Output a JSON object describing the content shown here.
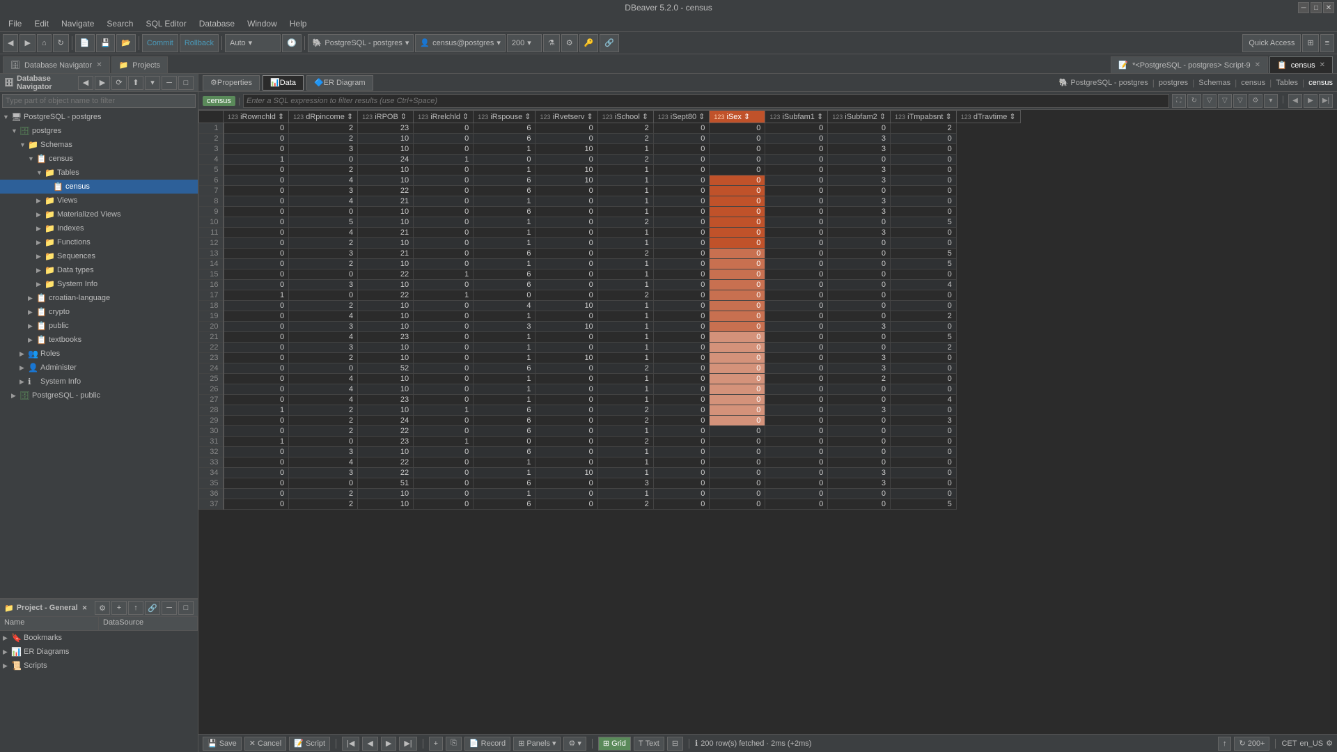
{
  "titlebar": {
    "title": "DBeaver 5.2.0 - census"
  },
  "menubar": {
    "items": [
      "File",
      "Edit",
      "Navigate",
      "Search",
      "SQL Editor",
      "Database",
      "Window",
      "Help"
    ]
  },
  "toolbar": {
    "commit_label": "Commit",
    "rollback_label": "Rollback",
    "auto_label": "Auto",
    "db_connection": "PostgreSQL - postgres",
    "schema": "census@postgres",
    "limit": "200",
    "quick_access": "Quick Access"
  },
  "tabs": {
    "items": [
      {
        "label": "Database Navigator",
        "active": false,
        "closeable": true
      },
      {
        "label": "Projects",
        "active": false,
        "closeable": false
      }
    ],
    "editor_tabs": [
      {
        "label": "*<PostgreSQL - postgres> Script-9",
        "active": false,
        "closeable": true
      },
      {
        "label": "census",
        "active": true,
        "closeable": true
      }
    ]
  },
  "navigator": {
    "title": "Database Navigator",
    "search_placeholder": "Type part of object name to filter",
    "tree": [
      {
        "level": 0,
        "expanded": true,
        "icon": "🖥",
        "label": "PostgreSQL - postgres"
      },
      {
        "level": 1,
        "expanded": true,
        "icon": "🗄",
        "label": "postgres"
      },
      {
        "level": 2,
        "expanded": true,
        "icon": "📁",
        "label": "Schemas"
      },
      {
        "level": 3,
        "expanded": true,
        "icon": "📋",
        "label": "census"
      },
      {
        "level": 4,
        "expanded": true,
        "icon": "📁",
        "label": "Tables"
      },
      {
        "level": 5,
        "expanded": false,
        "icon": "📋",
        "label": "census",
        "selected": true
      },
      {
        "level": 4,
        "expanded": false,
        "icon": "📁",
        "label": "Views"
      },
      {
        "level": 4,
        "expanded": false,
        "icon": "📁",
        "label": "Materialized Views"
      },
      {
        "level": 4,
        "expanded": false,
        "icon": "📁",
        "label": "Indexes"
      },
      {
        "level": 4,
        "expanded": false,
        "icon": "📁",
        "label": "Functions"
      },
      {
        "level": 4,
        "expanded": false,
        "icon": "📁",
        "label": "Sequences"
      },
      {
        "level": 4,
        "expanded": false,
        "icon": "📁",
        "label": "Data types"
      },
      {
        "level": 4,
        "expanded": false,
        "icon": "📁",
        "label": "System Info"
      },
      {
        "level": 3,
        "expanded": false,
        "icon": "📋",
        "label": "croatian-language"
      },
      {
        "level": 3,
        "expanded": false,
        "icon": "📋",
        "label": "crypto"
      },
      {
        "level": 3,
        "expanded": false,
        "icon": "📋",
        "label": "public"
      },
      {
        "level": 3,
        "expanded": false,
        "icon": "📋",
        "label": "textbooks"
      },
      {
        "level": 2,
        "expanded": false,
        "icon": "👥",
        "label": "Roles"
      },
      {
        "level": 2,
        "expanded": false,
        "icon": "👤",
        "label": "Administer"
      },
      {
        "level": 2,
        "expanded": false,
        "icon": "ℹ",
        "label": "System Info"
      },
      {
        "level": 1,
        "expanded": false,
        "icon": "🗄",
        "label": "PostgreSQL - public"
      }
    ]
  },
  "project_panel": {
    "title": "Project - General",
    "columns": [
      "Name",
      "DataSource"
    ],
    "items": [
      {
        "icon": "🔖",
        "label": "Bookmarks",
        "expanded": false
      },
      {
        "icon": "📊",
        "label": "ER Diagrams",
        "expanded": false
      },
      {
        "icon": "📜",
        "label": "Scripts",
        "expanded": false
      }
    ]
  },
  "data_panel": {
    "tabs": [
      "Properties",
      "Data",
      "ER Diagram"
    ],
    "active_tab": "Data",
    "filter_placeholder": "Enter a SQL expression to filter results (use Ctrl+Space)",
    "table_name": "census",
    "columns": [
      {
        "name": "iRownchld",
        "type": "123"
      },
      {
        "name": "dRpincome",
        "type": "123"
      },
      {
        "name": "iRPOB",
        "type": "123"
      },
      {
        "name": "iRrelchld",
        "type": "123"
      },
      {
        "name": "iRspouse",
        "type": "123"
      },
      {
        "name": "iRvetserv",
        "type": "123"
      },
      {
        "name": "iSchool",
        "type": "123"
      },
      {
        "name": "iSept80",
        "type": "123"
      },
      {
        "name": "iSex",
        "type": "123",
        "highlighted": true
      },
      {
        "name": "iSubfam1",
        "type": "123"
      },
      {
        "name": "iSubfam2",
        "type": "123"
      },
      {
        "name": "iTmpabsnt",
        "type": "123"
      },
      {
        "name": "dTravtime",
        "type": "123"
      }
    ],
    "rows": [
      [
        1,
        0,
        2,
        23,
        0,
        6,
        0,
        2,
        0,
        0,
        0,
        0,
        2
      ],
      [
        2,
        0,
        2,
        10,
        0,
        6,
        0,
        2,
        0,
        0,
        0,
        3,
        0
      ],
      [
        3,
        0,
        3,
        10,
        0,
        1,
        10,
        1,
        0,
        0,
        0,
        3,
        0
      ],
      [
        4,
        1,
        0,
        24,
        1,
        0,
        0,
        2,
        0,
        0,
        0,
        0,
        0
      ],
      [
        5,
        0,
        2,
        10,
        0,
        1,
        10,
        1,
        0,
        0,
        0,
        3,
        0
      ],
      [
        6,
        0,
        4,
        10,
        0,
        6,
        10,
        1,
        0,
        0,
        0,
        3,
        0
      ],
      [
        7,
        0,
        3,
        22,
        0,
        6,
        0,
        1,
        0,
        0,
        0,
        0,
        0
      ],
      [
        8,
        0,
        4,
        21,
        0,
        1,
        0,
        1,
        0,
        0,
        0,
        3,
        0
      ],
      [
        9,
        0,
        0,
        10,
        0,
        6,
        0,
        1,
        0,
        0,
        0,
        3,
        0
      ],
      [
        10,
        0,
        5,
        10,
        0,
        1,
        0,
        2,
        0,
        0,
        0,
        0,
        5
      ],
      [
        11,
        0,
        4,
        21,
        0,
        1,
        0,
        1,
        0,
        0,
        0,
        3,
        0
      ],
      [
        12,
        0,
        2,
        10,
        0,
        1,
        0,
        1,
        0,
        0,
        0,
        0,
        0
      ],
      [
        13,
        0,
        3,
        21,
        0,
        6,
        0,
        2,
        0,
        0,
        0,
        0,
        5
      ],
      [
        14,
        0,
        2,
        10,
        0,
        1,
        0,
        1,
        0,
        0,
        0,
        0,
        5
      ],
      [
        15,
        0,
        0,
        22,
        1,
        6,
        0,
        1,
        0,
        0,
        0,
        0,
        0
      ],
      [
        16,
        0,
        3,
        10,
        0,
        6,
        0,
        1,
        0,
        0,
        0,
        0,
        4
      ],
      [
        17,
        1,
        0,
        22,
        1,
        0,
        0,
        2,
        0,
        0,
        0,
        0,
        0
      ],
      [
        18,
        0,
        2,
        10,
        0,
        4,
        10,
        1,
        0,
        0,
        0,
        0,
        0
      ],
      [
        19,
        0,
        4,
        10,
        0,
        1,
        0,
        1,
        0,
        0,
        0,
        0,
        2
      ],
      [
        20,
        0,
        3,
        10,
        0,
        3,
        10,
        1,
        0,
        0,
        0,
        3,
        0
      ],
      [
        21,
        0,
        4,
        23,
        0,
        1,
        0,
        1,
        0,
        0,
        0,
        0,
        5
      ],
      [
        22,
        0,
        3,
        10,
        0,
        1,
        0,
        1,
        0,
        0,
        0,
        0,
        2
      ],
      [
        23,
        0,
        2,
        10,
        0,
        1,
        10,
        1,
        0,
        0,
        0,
        3,
        0
      ],
      [
        24,
        0,
        0,
        52,
        0,
        6,
        0,
        2,
        0,
        0,
        0,
        3,
        0
      ],
      [
        25,
        0,
        4,
        10,
        0,
        1,
        0,
        1,
        0,
        0,
        0,
        2,
        0
      ],
      [
        26,
        0,
        4,
        10,
        0,
        1,
        0,
        1,
        0,
        0,
        0,
        0,
        0
      ],
      [
        27,
        0,
        4,
        23,
        0,
        1,
        0,
        1,
        0,
        0,
        0,
        0,
        4
      ],
      [
        28,
        1,
        2,
        10,
        1,
        6,
        0,
        2,
        0,
        0,
        0,
        3,
        0
      ],
      [
        29,
        0,
        2,
        24,
        0,
        6,
        0,
        2,
        0,
        0,
        0,
        0,
        3
      ],
      [
        30,
        0,
        2,
        22,
        0,
        6,
        0,
        1,
        0,
        0,
        0,
        0,
        0
      ],
      [
        31,
        1,
        0,
        23,
        1,
        0,
        0,
        2,
        0,
        0,
        0,
        0,
        0
      ],
      [
        32,
        0,
        3,
        10,
        0,
        6,
        0,
        1,
        0,
        0,
        0,
        0,
        0
      ],
      [
        33,
        0,
        4,
        22,
        0,
        1,
        0,
        1,
        0,
        0,
        0,
        0,
        0
      ],
      [
        34,
        0,
        3,
        22,
        0,
        1,
        10,
        1,
        0,
        0,
        0,
        3,
        0
      ],
      [
        35,
        0,
        0,
        51,
        0,
        6,
        0,
        3,
        0,
        0,
        0,
        3,
        0
      ],
      [
        36,
        0,
        2,
        10,
        0,
        1,
        0,
        1,
        0,
        0,
        0,
        0,
        0
      ],
      [
        37,
        0,
        2,
        10,
        0,
        6,
        0,
        2,
        0,
        0,
        0,
        0,
        5
      ]
    ],
    "highlighted_rows": [
      6,
      7,
      8,
      9,
      10,
      11,
      12,
      13,
      14,
      15,
      16,
      17,
      18,
      19,
      20,
      21,
      22,
      23,
      24,
      25,
      26,
      27,
      28,
      29
    ],
    "status": "200 row(s) fetched · 2ms (+2ms)",
    "record_count": "200+"
  }
}
